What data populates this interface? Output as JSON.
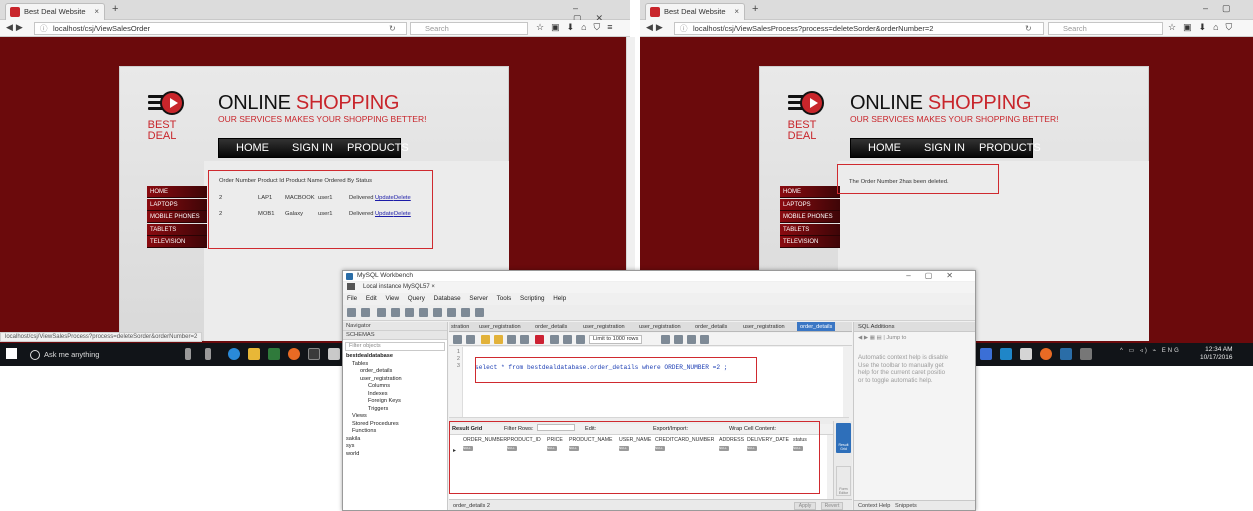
{
  "left_browser": {
    "tab_title": "Best Deal Website",
    "url": "localhost/csj/ViewSalesOrder",
    "search_placeholder": "Search",
    "status_url": "localhost/csj/ViewSalesProcess?process=deleteSorder&orderNumber=2"
  },
  "right_browser": {
    "tab_title": "Best Deal Website",
    "url": "localhost/csj/ViewSalesProcess?process=deleteSorder&orderNumber=2",
    "search_placeholder": "Search",
    "message": "The Order Number 2has been deleted."
  },
  "site": {
    "logo_line1": "BEST",
    "logo_line2": "DEAL",
    "brand_part1": "ONLINE ",
    "brand_part2": "SHOPPING",
    "tagline": "OUR SERVICES MAKES YOUR SHOPPING BETTER!",
    "menu": [
      "HOME",
      "SIGN IN",
      "PRODUCTS"
    ],
    "sidenav": [
      "HOME",
      "LAPTOPS",
      "MOBILE PHONES",
      "TABLETS",
      "TELEVISION"
    ]
  },
  "orders": {
    "header": "Order Number  Product Id  Product Name  Ordered By  Status",
    "rows": [
      {
        "number": "2",
        "product_id": "LAP1",
        "product_name": "MACBOOK",
        "ordered_by": "user1",
        "status": "Delivered",
        "update": "Update",
        "delete": "Delete"
      },
      {
        "number": "2",
        "product_id": "MOB1",
        "product_name": "Galaxy",
        "ordered_by": "user1",
        "status": "Delivered",
        "update": "Update",
        "delete": "Delete"
      }
    ]
  },
  "taskbar": {
    "search_placeholder": "Ask me anything",
    "time": "12:34 AM",
    "date": "10/17/2016",
    "lang": "ENG"
  },
  "workbench": {
    "title": "MySQL Workbench",
    "connection_tab": "Local instance MySQL57",
    "menu": "File  Edit  View  Query  Database  Server  Tools  Scripting  Help",
    "navigator_label": "Navigator",
    "schemas_label": "SCHEMAS",
    "filter_placeholder": "Filter objects",
    "tree": [
      "bestdealdatabase",
      "Tables",
      "order_details",
      "user_registration",
      "Columns",
      "Indexes",
      "Foreign Keys",
      "Triggers",
      "Views",
      "Stored Procedures",
      "Functions",
      "sakila",
      "sys",
      "world"
    ],
    "sql_tabs": [
      "stration",
      "user_registration",
      "order_details",
      "user_registration",
      "user_registration",
      "order_details",
      "user_registration",
      "order_details"
    ],
    "limit": "Limit to 1000 rows",
    "line_numbers": [
      "1",
      "2",
      "3"
    ],
    "query": "select * from bestdealdatabase.order_details where ORDER_NUMBER =2 ;",
    "result_toolbar": {
      "result_grid": "Result Grid",
      "filter_rows": "Filter Rows:",
      "edit": "Edit:",
      "export_import": "Export/Import:",
      "wrap": "Wrap Cell Content:"
    },
    "columns": [
      "ORDER_NUMBER",
      "PRODUCT_ID",
      "PRICE",
      "PRODUCT_NAME",
      "USER_NAME",
      "CREDITCARD_NUMBER",
      "ADDRESS",
      "DELIVERY_DATE",
      "status"
    ],
    "null_label": "NULL",
    "right_strip": {
      "result_grid": "Result Grid",
      "form_editor": "Form Editor"
    },
    "bottom_tab": "order_details 2",
    "apply": "Apply",
    "revert": "Revert",
    "sql_additions": "SQL Additions",
    "jump_to": "Jump to",
    "help_lines": [
      "Automatic context help is disable",
      "Use the toolbar to manually get",
      "help for the current caret positio",
      "or to toggle automatic help."
    ],
    "footer_tabs": [
      "Context Help",
      "Snippets"
    ]
  },
  "colors": {
    "brand_red": "#c8252b",
    "page_bg": "#6b0a0c",
    "annotation_box": "#cf2a2f"
  }
}
